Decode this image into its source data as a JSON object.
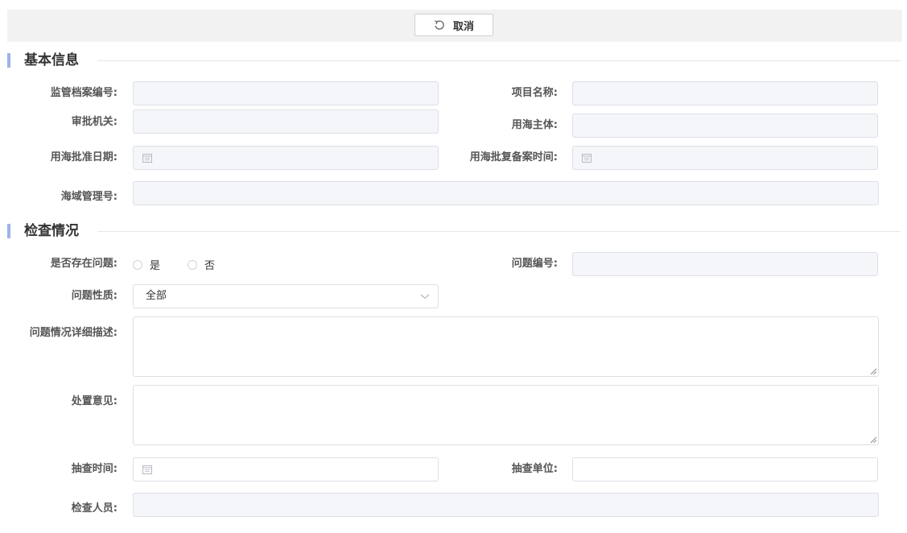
{
  "toolbar": {
    "cancel_label": "取消"
  },
  "sections": {
    "basic": "基本信息",
    "inspection": "检查情况"
  },
  "basic": {
    "archive_no_label": "监管档案编号:",
    "project_name_label": "项目名称:",
    "authority_label": "审批机关:",
    "sea_user_label": "用海主体:",
    "approval_date_label": "用海批准日期:",
    "record_time_label": "用海批复备案时间:",
    "sea_area_no_label": "海域管理号:"
  },
  "inspection": {
    "has_problem_label": "是否存在问题:",
    "yes_label": "是",
    "no_label": "否",
    "problem_no_label": "问题编号:",
    "problem_nature_label": "问题性质:",
    "problem_nature_value": "全部",
    "description_label": "问题情况详细描述:",
    "opinion_label": "处置意见:",
    "check_time_label": "抽查时间:",
    "check_unit_label": "抽查单位:",
    "inspector_label": "检查人员:"
  },
  "colors": {
    "accent_bar": "#9db3ea",
    "disabled_field": "#f5f6fa",
    "border": "#dcdfe6"
  }
}
